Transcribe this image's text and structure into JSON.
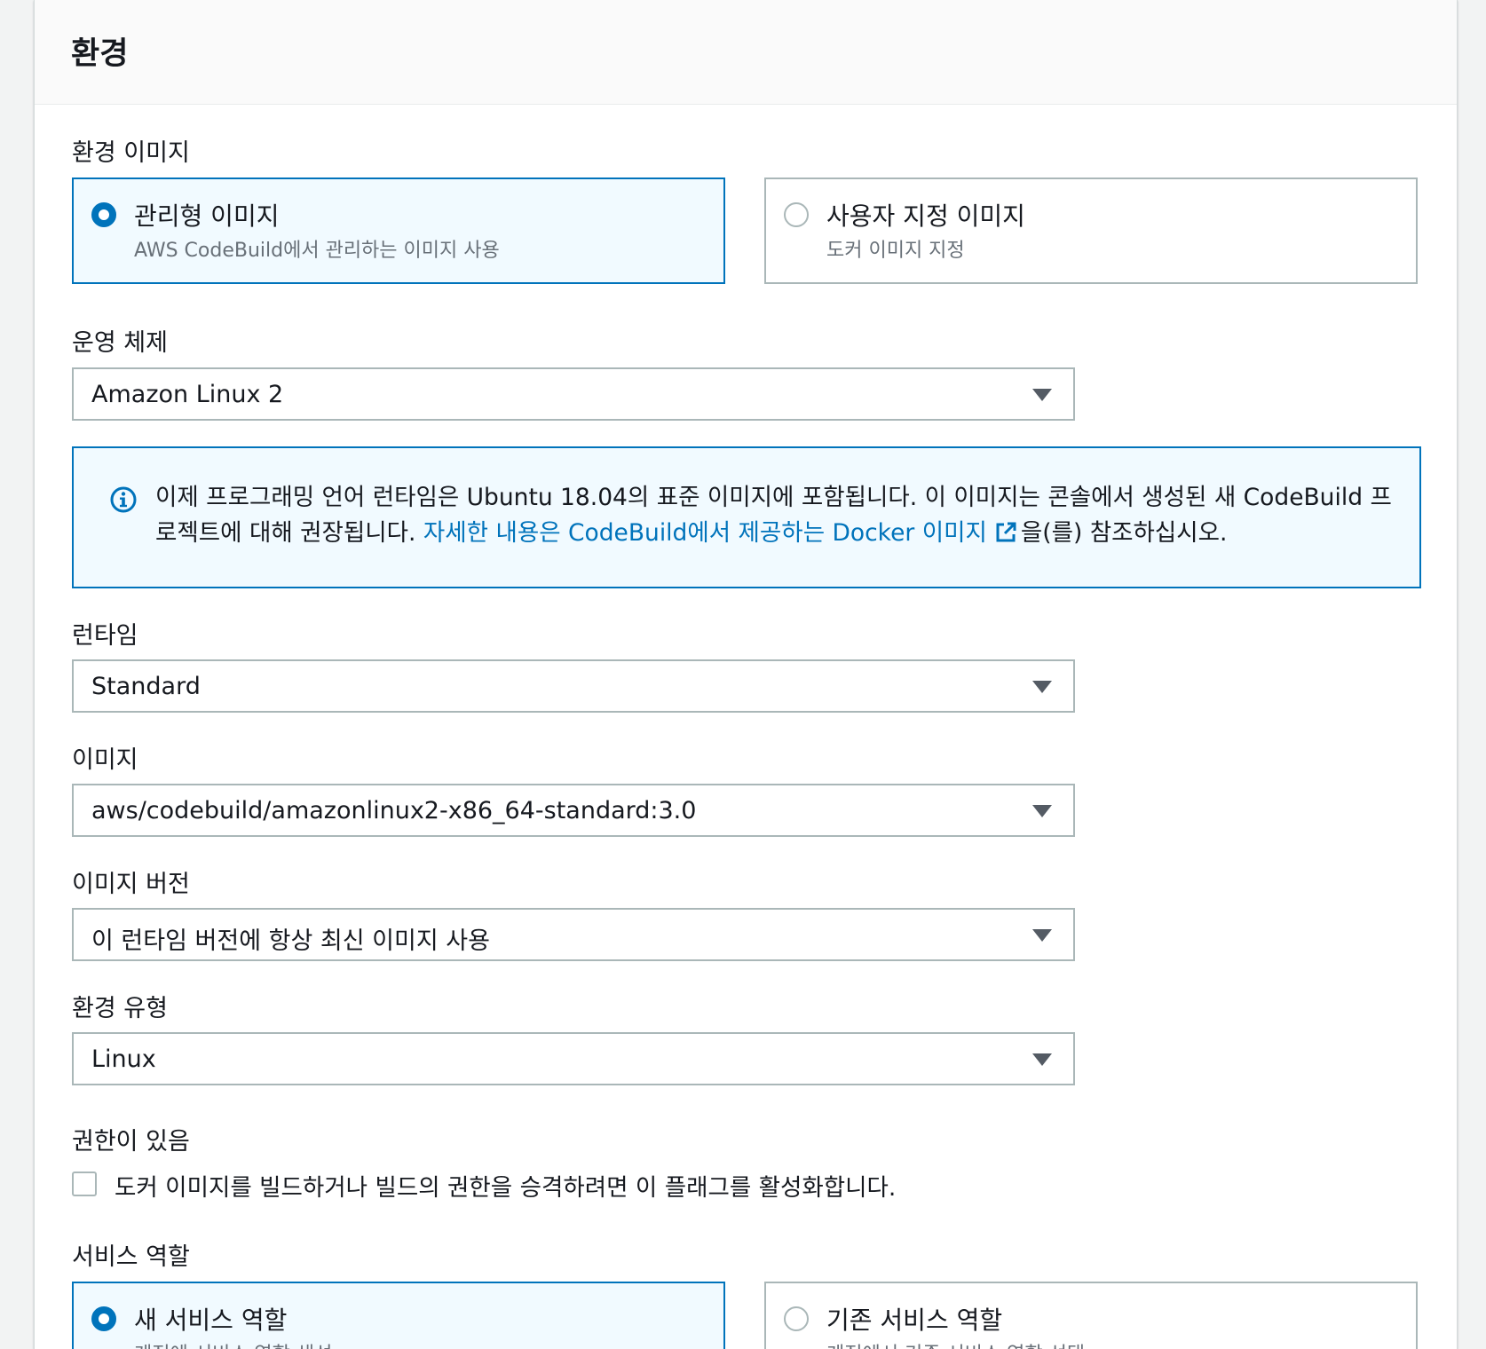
{
  "panel": {
    "title": "환경"
  },
  "environment_image": {
    "label": "환경 이미지",
    "options": [
      {
        "title": "관리형 이미지",
        "description": "AWS CodeBuild에서 관리하는 이미지 사용",
        "selected": true
      },
      {
        "title": "사용자 지정 이미지",
        "description": "도커 이미지 지정",
        "selected": false
      }
    ]
  },
  "operating_system": {
    "label": "운영 체제",
    "value": "Amazon Linux 2"
  },
  "info_alert": {
    "icon": "info-icon",
    "text_before": "이제 프로그래밍 언어 런타임은 Ubuntu 18.04의 표준 이미지에 포함됩니다. 이 이미지는 콘솔에서 생성된 새 CodeBuild 프로젝트에 대해 권장됩니다. ",
    "link_text": "자세한 내용은 CodeBuild에서 제공하는 Docker 이미지",
    "link_icon": "external-link-icon",
    "text_after": "을(를) 참조하십시오."
  },
  "runtime": {
    "label": "런타임",
    "value": "Standard"
  },
  "image": {
    "label": "이미지",
    "value": "aws/codebuild/amazonlinux2-x86_64-standard:3.0"
  },
  "image_version": {
    "label": "이미지 버전",
    "value": "이 런타임 버전에 항상 최신 이미지 사용"
  },
  "environment_type": {
    "label": "환경 유형",
    "value": "Linux"
  },
  "privileged": {
    "label": "권한이 있음",
    "checkbox_label": "도커 이미지를 빌드하거나 빌드의 권한을 승격하려면 이 플래그를 활성화합니다.",
    "checked": false
  },
  "service_role": {
    "label": "서비스 역할",
    "options": [
      {
        "title": "새 서비스 역할",
        "description": "계정에 서비스 역할 생성",
        "selected": true
      },
      {
        "title": "기존 서비스 역할",
        "description": "계정에서 기존 서비스 역할 선택",
        "selected": false
      }
    ]
  },
  "colors": {
    "accent": "#0073bb",
    "border": "#aab7b8",
    "muted": "#687078"
  }
}
